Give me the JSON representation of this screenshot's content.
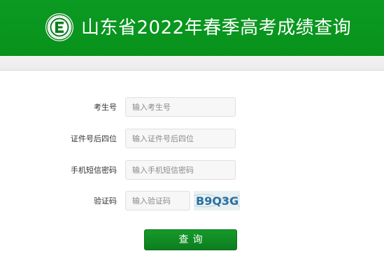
{
  "header": {
    "title": "山东省2022年春季高考成绩查询",
    "logo_icon": "exam-authority-seal-icon",
    "background_color": "#0b9a22"
  },
  "form": {
    "exam_number": {
      "label": "考生号",
      "placeholder": "输入考生号"
    },
    "id_last4": {
      "label": "证件号后四位",
      "placeholder": "输入证件号后四位"
    },
    "sms_code": {
      "label": "手机短信密码",
      "placeholder": "输入手机短信密码"
    },
    "captcha": {
      "label": "验证码",
      "placeholder": "输入验证码",
      "image_text": "B9Q3G"
    },
    "submit_label": "查询",
    "button_color": "#0d7d1f"
  }
}
